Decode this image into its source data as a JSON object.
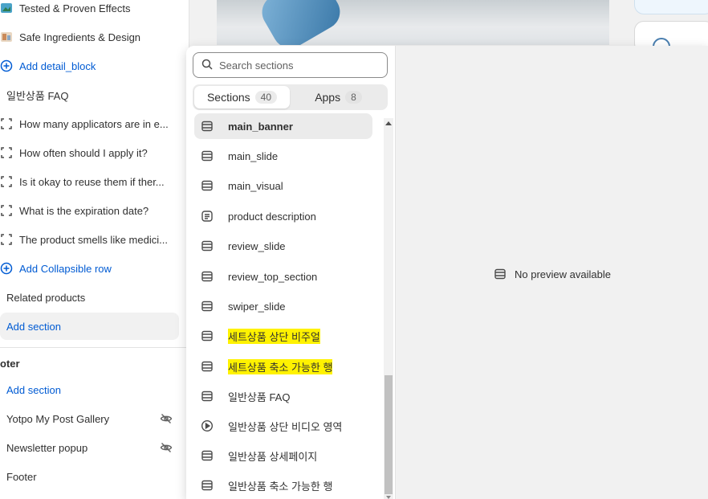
{
  "sidebar": {
    "items": [
      {
        "label": "Tested & Proven Effects",
        "icon": "image-icon"
      },
      {
        "label": "Safe Ingredients & Design",
        "icon": "image-icon"
      },
      {
        "label": "Add detail_block",
        "icon": "plus-circle-icon"
      },
      {
        "label": "일반상품 FAQ",
        "icon": "none"
      },
      {
        "label": "How many applicators are in e...",
        "icon": "block-icon"
      },
      {
        "label": "How often should I apply it?",
        "icon": "block-icon"
      },
      {
        "label": "Is it okay to reuse them if ther...",
        "icon": "block-icon"
      },
      {
        "label": "What is the expiration date?",
        "icon": "block-icon"
      },
      {
        "label": "The product smells like medici...",
        "icon": "block-icon"
      },
      {
        "label": "Add Collapsible row",
        "icon": "plus-circle-icon"
      },
      {
        "label": "Related products",
        "icon": "none"
      },
      {
        "label": "Add section",
        "icon": "plus-circle-icon"
      }
    ],
    "footer_heading": "oter",
    "footer_items": [
      {
        "label": "Add section"
      },
      {
        "label": "Yotpo My Post Gallery"
      },
      {
        "label": "Newsletter popup"
      },
      {
        "label": "Footer"
      }
    ]
  },
  "popover": {
    "search_placeholder": "Search sections",
    "tabs": [
      {
        "label": "Sections",
        "count": "40"
      },
      {
        "label": "Apps",
        "count": "8"
      }
    ],
    "sections": [
      {
        "label": "main_banner",
        "icon": "section-icon",
        "selected": true
      },
      {
        "label": "main_slide",
        "icon": "section-icon"
      },
      {
        "label": "main_visual",
        "icon": "section-icon"
      },
      {
        "label": "product description",
        "icon": "text-block-icon"
      },
      {
        "label": "review_slide",
        "icon": "section-icon"
      },
      {
        "label": "review_top_section",
        "icon": "section-icon"
      },
      {
        "label": "swiper_slide",
        "icon": "section-icon"
      },
      {
        "label": "세트상품 상단 비주얼",
        "icon": "section-icon",
        "highlighted": true
      },
      {
        "label": "세트상품 축소 가능한 행",
        "icon": "section-icon",
        "highlighted": true
      },
      {
        "label": "일반상품 FAQ",
        "icon": "section-icon"
      },
      {
        "label": "일반상품 상단 비디오 영역",
        "icon": "play-circle-icon"
      },
      {
        "label": "일반상품 상세페이지",
        "icon": "section-icon"
      },
      {
        "label": "일반상품 축소 가능한 행",
        "icon": "section-icon"
      }
    ],
    "preview_message": "No preview available"
  },
  "colors": {
    "link": "#005bd3",
    "highlight": "#fff200"
  }
}
